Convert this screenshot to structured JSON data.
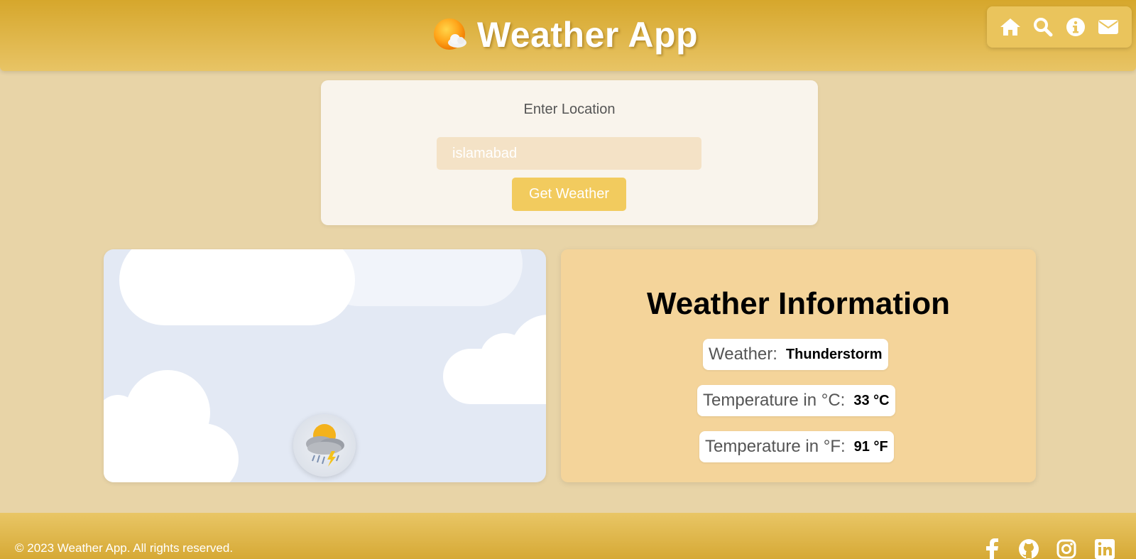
{
  "header": {
    "title": "Weather App",
    "logo_icon": "sun-cloud-icon",
    "nav": [
      {
        "icon": "home-icon"
      },
      {
        "icon": "search-icon"
      },
      {
        "icon": "info-icon"
      },
      {
        "icon": "envelope-icon"
      }
    ]
  },
  "search": {
    "label": "Enter Location",
    "input_value": "islamabad",
    "button_label": "Get Weather"
  },
  "sky": {
    "weather_icon": "thunderstorm-icon"
  },
  "info": {
    "title": "Weather Information",
    "rows": [
      {
        "label": "Weather:",
        "value": "Thunderstorm"
      },
      {
        "label": "Temperature in °C:",
        "value": "33 °C"
      },
      {
        "label": "Temperature in °F:",
        "value": "91 °F"
      }
    ]
  },
  "footer": {
    "copyright": "© 2023 Weather App. All rights reserved.",
    "social": [
      {
        "icon": "facebook-icon"
      },
      {
        "icon": "github-icon"
      },
      {
        "icon": "instagram-icon"
      },
      {
        "icon": "linkedin-icon"
      }
    ]
  },
  "colors": {
    "background": "#e8d4a7",
    "header": "#d6a72c",
    "card_light": "#f9f4ec",
    "card_info": "#f4d49a",
    "button": "#f2cb5e",
    "sky": "#e3e9f4"
  }
}
